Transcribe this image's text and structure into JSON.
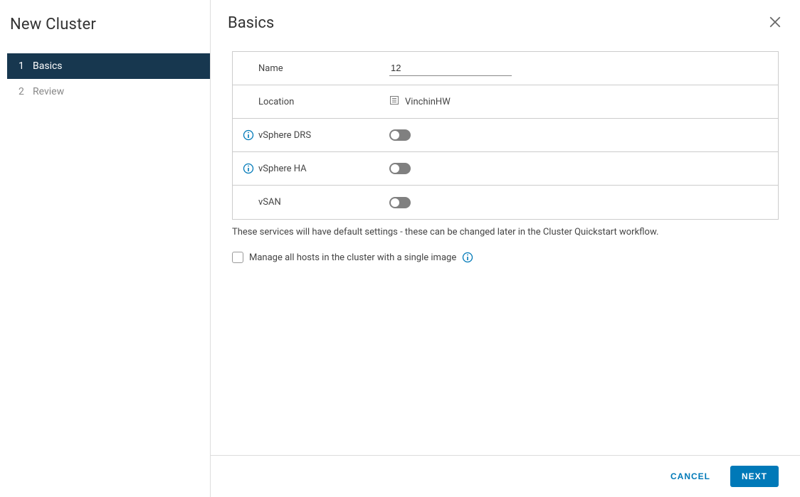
{
  "sidebar": {
    "title": "New Cluster",
    "steps": [
      {
        "number": "1",
        "label": "Basics",
        "active": true
      },
      {
        "number": "2",
        "label": "Review",
        "active": false
      }
    ]
  },
  "main": {
    "title": "Basics",
    "rows": {
      "name_label": "Name",
      "name_value": "12",
      "location_label": "Location",
      "location_value": "VinchinHW",
      "drs_label": "vSphere DRS",
      "drs_on": false,
      "ha_label": "vSphere HA",
      "ha_on": false,
      "vsan_label": "vSAN",
      "vsan_on": false
    },
    "hint": "These services will have default settings - these can be changed later in the Cluster Quickstart workflow.",
    "checkbox_label": "Manage all hosts in the cluster with a single image",
    "checkbox_checked": false
  },
  "footer": {
    "cancel": "CANCEL",
    "next": "NEXT"
  }
}
